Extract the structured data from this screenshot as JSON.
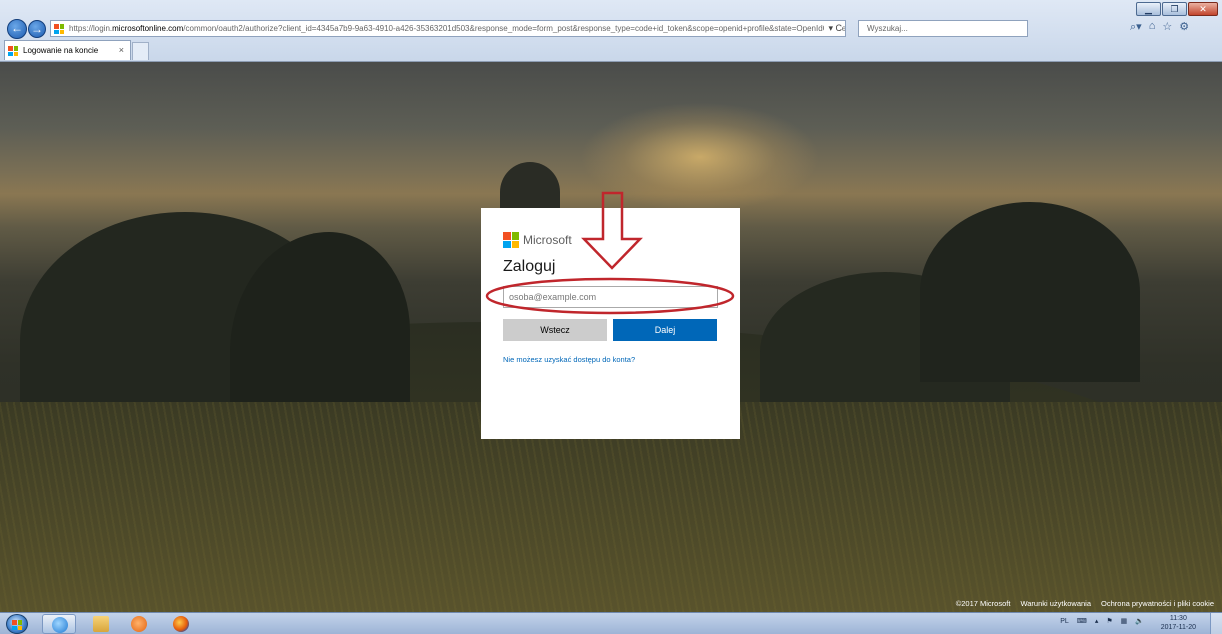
{
  "browser": {
    "url_prefix": "https://login.",
    "url_host": "microsoftonline.com",
    "url_rest": "/common/oauth2/authorize?client_id=4345a7b9-9a63-4910-a426-35363201d503&response_mode=form_post&response_type=code+id_token&scope=openid+profile&state=OpenIdConnect.Auth",
    "address_tools": "▾ C",
    "search_placeholder": "Wyszukaj...",
    "tab_title": "Logowanie na koncie",
    "tab_close": "×"
  },
  "signin": {
    "brand": "Microsoft",
    "heading": "Zaloguj",
    "email_placeholder": "osoba@example.com",
    "back_label": "Wstecz",
    "next_label": "Dalej",
    "help_link": "Nie możesz uzyskać dostępu do konta?"
  },
  "footer": {
    "copyright": "©2017 Microsoft",
    "terms": "Warunki użytkowania",
    "privacy": "Ochrona prywatności i pliki cookie"
  },
  "taskbar": {
    "language": "PL",
    "time": "11:30",
    "date": "2017-11-20"
  },
  "annotations": {
    "highlight_color": "#c0262c",
    "arrow_color": "#c0262c"
  },
  "colors": {
    "ms_red": "#f25022",
    "ms_green": "#7fba00",
    "ms_blue": "#00a4ef",
    "ms_yellow": "#ffb900",
    "primary_button": "#0067b8"
  }
}
